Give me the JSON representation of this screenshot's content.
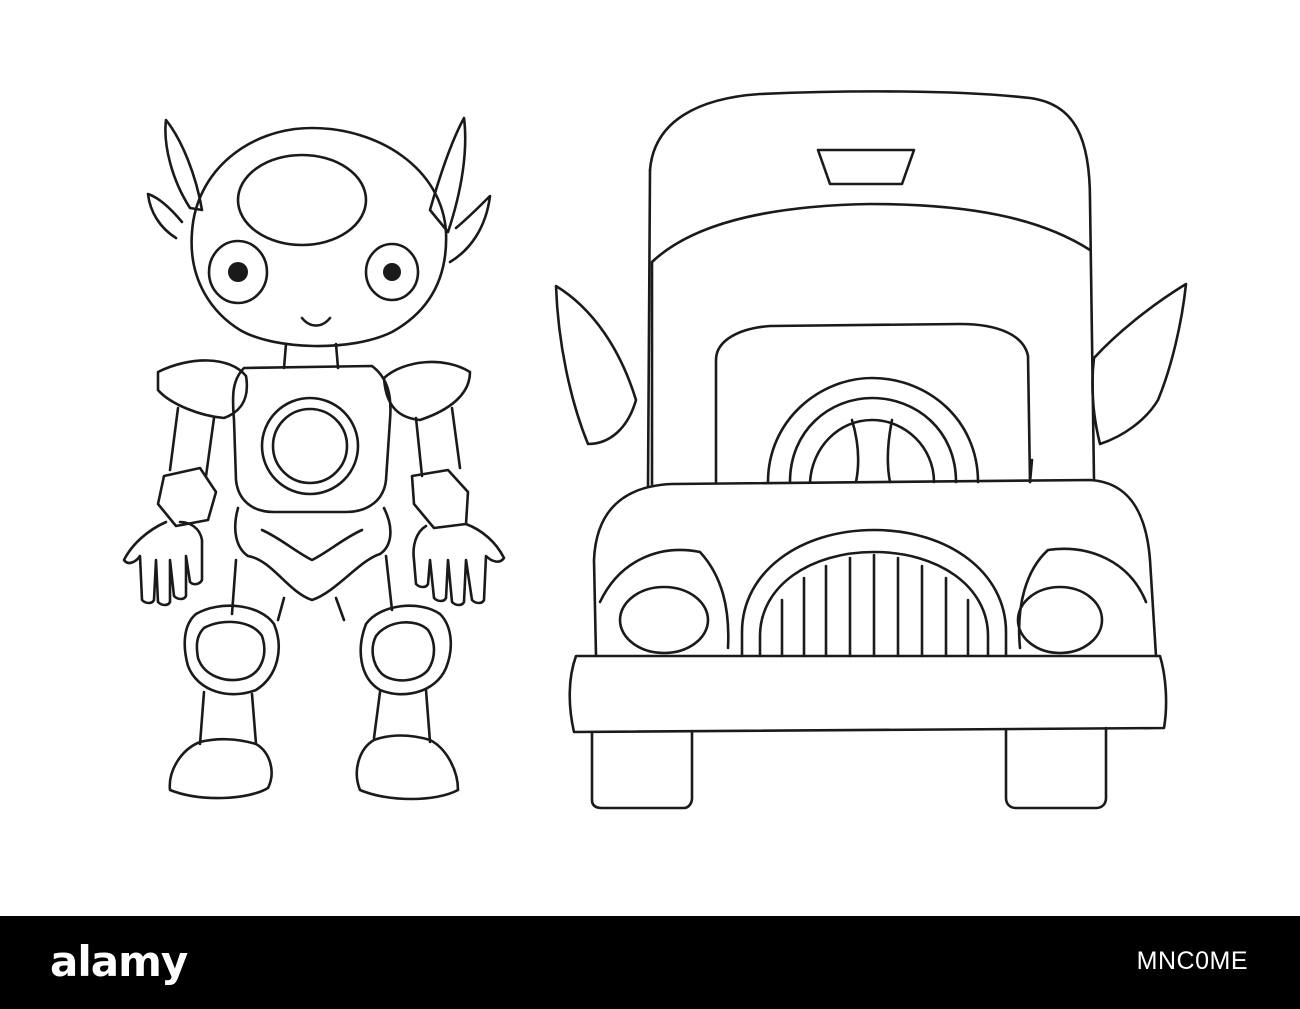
{
  "illustration": {
    "subjects": [
      "robot-figure",
      "truck-front"
    ],
    "line_color": "#1a1a1a",
    "background_color": "#ffffff"
  },
  "watermark": {
    "logo_text": "alamy",
    "image_code": "MNC0ME",
    "bar_color": "#000000",
    "text_color": "#ffffff"
  }
}
